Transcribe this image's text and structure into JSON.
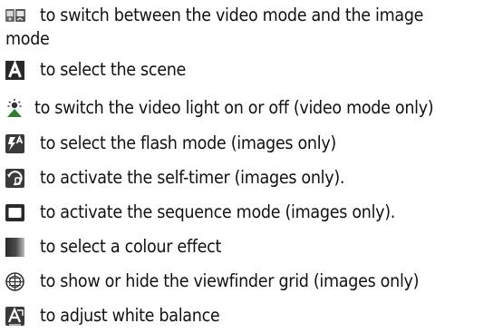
{
  "items": [
    {
      "icon": "video-image-mode-icon",
      "text_line1": "to switch between the video mode and the image",
      "text_line2": "mode"
    },
    {
      "icon": "scene-mode-icon",
      "text": "to select the scene"
    },
    {
      "icon": "video-light-icon",
      "text": "to switch the video light on or off (video mode only)"
    },
    {
      "icon": "flash-mode-icon",
      "text": "to select the flash mode (images only)"
    },
    {
      "icon": "self-timer-icon",
      "text": "to activate the self-timer (images only)."
    },
    {
      "icon": "sequence-mode-icon",
      "text": "to activate the sequence mode (images only)."
    },
    {
      "icon": "colour-effect-icon",
      "text": "to select a colour effect"
    },
    {
      "icon": "viewfinder-grid-icon",
      "text": "to show or hide the viewfinder grid (images only)"
    },
    {
      "icon": "white-balance-icon",
      "text": "to adjust white balance"
    }
  ]
}
